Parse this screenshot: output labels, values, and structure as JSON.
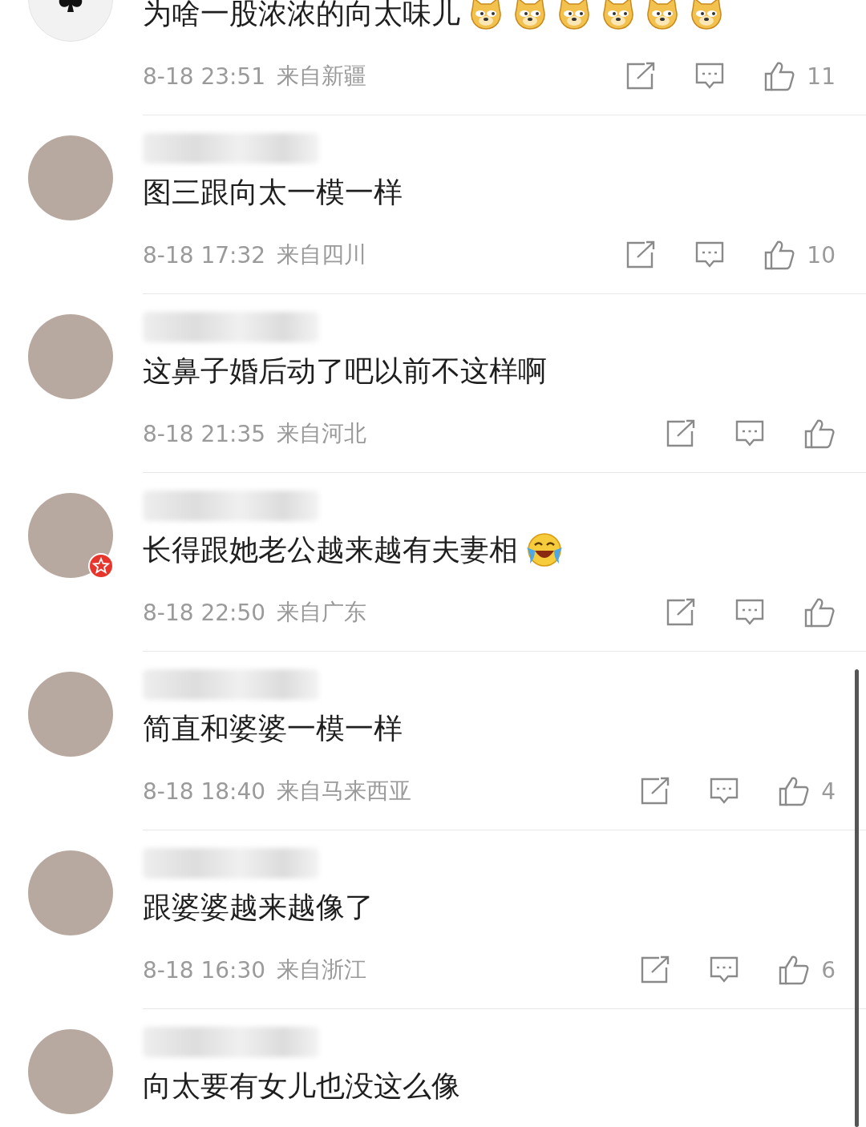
{
  "comments": [
    {
      "avatar": {
        "kind": "spade",
        "badge": false
      },
      "text": "为啥一股浓浓的向太味儿",
      "emojis": [
        {
          "kind": "doge"
        },
        {
          "kind": "doge"
        },
        {
          "kind": "doge"
        },
        {
          "kind": "doge"
        },
        {
          "kind": "doge"
        },
        {
          "kind": "doge"
        }
      ],
      "time": "8-18 23:51",
      "location": "来自新疆",
      "likes": "11"
    },
    {
      "avatar": {
        "kind": "photo",
        "badge": false
      },
      "text": "图三跟向太一模一样",
      "time": "8-18 17:32",
      "location": "来自四川",
      "likes": "10"
    },
    {
      "avatar": {
        "kind": "photo",
        "badge": false
      },
      "text": "这鼻子婚后动了吧以前不这样啊",
      "time": "8-18 21:35",
      "location": "来自河北"
    },
    {
      "avatar": {
        "kind": "photo",
        "badge": true
      },
      "text": "长得跟她老公越来越有夫妻相",
      "emojis": [
        {
          "kind": "laughing"
        }
      ],
      "time": "8-18 22:50",
      "location": "来自广东"
    },
    {
      "avatar": {
        "kind": "photo",
        "badge": false
      },
      "text": "简直和婆婆一模一样",
      "time": "8-18 18:40",
      "location": "来自马来西亚",
      "likes": "4"
    },
    {
      "avatar": {
        "kind": "photo",
        "badge": false
      },
      "text": "跟婆婆越来越像了",
      "time": "8-18 16:30",
      "location": "来自浙江",
      "likes": "6"
    },
    {
      "avatar": {
        "kind": "photo",
        "badge": false
      },
      "text": "向太要有女儿也没这么像"
    }
  ]
}
